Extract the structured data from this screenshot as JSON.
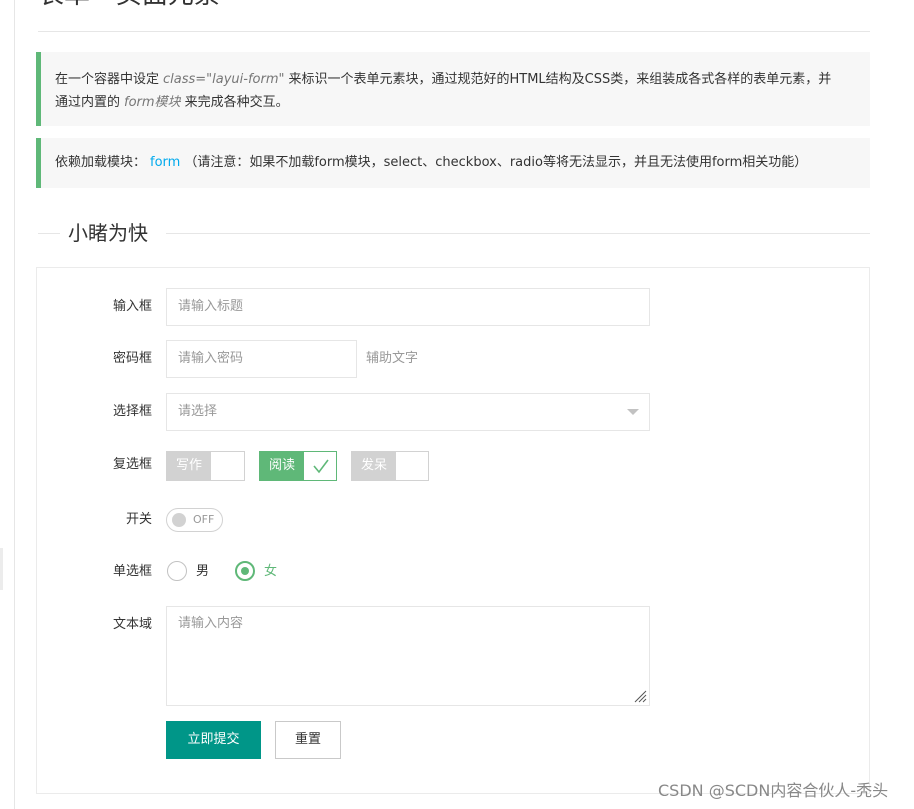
{
  "page": {
    "title": "表单 - 页面元素"
  },
  "notes": {
    "intro": {
      "text_before": "在一个容器中设定",
      "class_code": "class=\"layui-form\"",
      "text_middle": "来标识一个表单元素块，通过规范好的HTML结构及CSS类，来组装成各式各样的表单元素，并通过内置的",
      "module_code": "form模块",
      "text_after": "来完成各种交互。"
    },
    "dependency": {
      "prefix": "依赖加载模块：",
      "module_link": "form",
      "warning": "（请注意：如果不加载form模块，select、checkbox、radio等将无法显示，并且无法使用form相关功能）"
    }
  },
  "section": {
    "legend": "小睹为快"
  },
  "form": {
    "title_field": {
      "label": "输入框",
      "placeholder": "请输入标题"
    },
    "password_field": {
      "label": "密码框",
      "placeholder": "请输入密码",
      "aux": "辅助文字"
    },
    "select_field": {
      "label": "选择框",
      "placeholder": "请选择"
    },
    "checkbox_group": {
      "label": "复选框",
      "options": [
        {
          "label": "写作",
          "checked": false
        },
        {
          "label": "阅读",
          "checked": true
        },
        {
          "label": "发呆",
          "checked": false
        }
      ]
    },
    "switch_field": {
      "label": "开关",
      "state": "OFF"
    },
    "radio_group": {
      "label": "单选框",
      "options": [
        {
          "label": "男",
          "checked": false
        },
        {
          "label": "女",
          "checked": true
        }
      ]
    },
    "textarea_field": {
      "label": "文本域",
      "placeholder": "请输入内容"
    },
    "buttons": {
      "submit": "立即提交",
      "reset": "重置"
    }
  },
  "watermark": "CSDN @SCDN内容合伙人-秃头",
  "colors": {
    "accent_green": "#5fb878",
    "primary_teal": "#009688",
    "link_blue": "#01aaed",
    "border": "#e6e6e6",
    "placeholder": "#999999"
  }
}
